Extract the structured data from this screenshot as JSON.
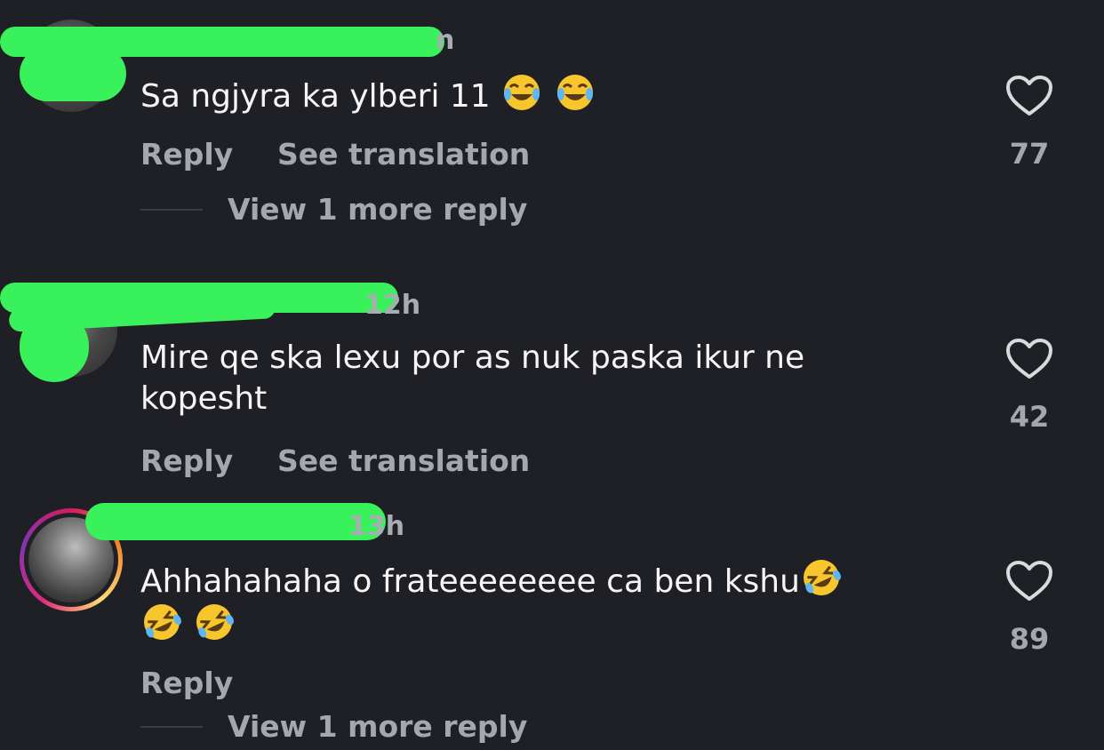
{
  "comments": [
    {
      "meta": "n",
      "text": "Sa ngjyra ka ylberi 11",
      "emojis": [
        "face-with-tears-of-joy",
        "face-with-tears-of-joy"
      ],
      "reply_label": "Reply",
      "translate_label": "See translation",
      "view_more": "View 1 more reply",
      "likes": "77"
    },
    {
      "meta": "12h",
      "text": "Mire qe ska lexu por as nuk paska ikur ne kopesht",
      "reply_label": "Reply",
      "translate_label": "See translation",
      "likes": "42"
    },
    {
      "meta": "13h",
      "text": "Ahhahahaha o frateeeeeeee ca ben kshu",
      "emojis": [
        "rolling-on-floor-laughing",
        "rolling-on-floor-laughing",
        "rolling-on-floor-laughing"
      ],
      "reply_label": "Reply",
      "view_more": "View 1 more reply",
      "likes": "89"
    }
  ],
  "colors": {
    "background": "#1f2026",
    "redaction": "#39f25b",
    "secondary_text": "#a3a7ae"
  },
  "icons": {
    "like": "heart-outline-icon"
  }
}
